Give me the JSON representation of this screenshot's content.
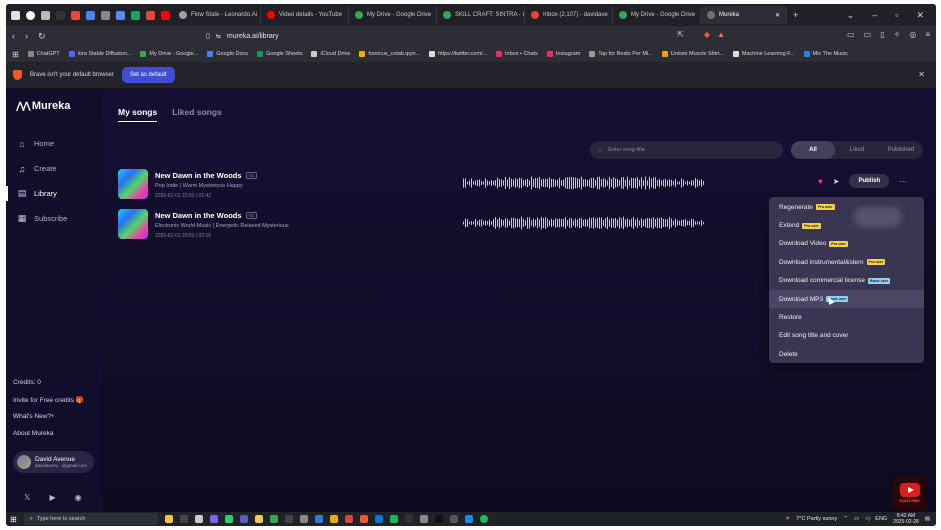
{
  "browser": {
    "tabs": [
      {
        "label": "Flow State - Leonardo.Ai",
        "color": "#9aa0a6"
      },
      {
        "label": "Video details - YouTube",
        "color": "#ff0000"
      },
      {
        "label": "My Drive - Google Drive",
        "color": "#34a853"
      },
      {
        "label": "SKILL CRAFT: SINTRA - G",
        "color": "#34a853"
      },
      {
        "label": "Inbox (2,107) - davidave",
        "color": "#ea4335"
      },
      {
        "label": "My Drive - Google Drive",
        "color": "#34a853"
      },
      {
        "label": "Mureka",
        "color": "#6f6f6f",
        "active": true
      }
    ],
    "url": "mureka.ai/library",
    "bookmarks": [
      {
        "label": "ChatGPT",
        "color": "#888"
      },
      {
        "label": "lora Stable Diffusion...",
        "color": "#4a6cf7"
      },
      {
        "label": "My Drive - Google...",
        "color": "#34a853"
      },
      {
        "label": "Google Docs",
        "color": "#4285f4"
      },
      {
        "label": "Google Sheets",
        "color": "#0f9d58"
      },
      {
        "label": "iCloud Drive",
        "color": "#ccc"
      },
      {
        "label": "fooocus_colab.ipyn...",
        "color": "#f9ab00"
      },
      {
        "label": "https://twitter.com/...",
        "color": "#ddd"
      },
      {
        "label": "Inbox • Chats",
        "color": "#e1306c"
      },
      {
        "label": "Instagram",
        "color": "#e1306c"
      },
      {
        "label": "Tap for Beats Per Mi...",
        "color": "#999"
      },
      {
        "label": "Unisex Muscle Shirt...",
        "color": "#f59e0b"
      },
      {
        "label": "Machine Learning F...",
        "color": "#ddd"
      },
      {
        "label": "Mix The Music",
        "color": "#1e88e5"
      }
    ],
    "infobar": {
      "message": "Brave isn't your default browser",
      "button": "Set as default"
    }
  },
  "app": {
    "logo": "Mureka",
    "nav": [
      {
        "label": "Home",
        "icon": "⌂"
      },
      {
        "label": "Create",
        "icon": "♫"
      },
      {
        "label": "Library",
        "icon": "▤",
        "active": true
      },
      {
        "label": "Subscribe",
        "icon": "▦"
      }
    ],
    "sidebar_bottom": {
      "credits": "Credits: 0",
      "invite": "Invite for Free credits 🎁",
      "whats_new": "What's New?",
      "about": "About Mureka"
    },
    "user": {
      "name": "David Avenue",
      "email": "davidavenu...@gmail.com"
    },
    "tabs": {
      "my_songs": "My songs",
      "liked_songs": "Liked songs"
    },
    "search_placeholder": "Enter song title",
    "filters": [
      "All",
      "Liked",
      "Published"
    ],
    "songs": [
      {
        "title": "New Dawn in the Woods",
        "version": "V1",
        "genre": "Pop Indie | Warm Mysterious Happy",
        "meta": "2025-01-01 23:02 | 01:42"
      },
      {
        "title": "New Dawn in the Woods",
        "version": "V2",
        "genre": "Electronic World-Music | Energetic Relaxed Mysterious",
        "meta": "2025-01-01 23:02 | 02:16"
      }
    ],
    "publish_label": "Publish",
    "menu": [
      {
        "label": "Regenerate",
        "badge": "Pro user",
        "badge_type": "pro"
      },
      {
        "label": "Extend",
        "badge": "Pro user",
        "badge_type": "pro"
      },
      {
        "label": "Download Video",
        "badge": "Pro user",
        "badge_type": "pro"
      },
      {
        "label": "Download instrumental&stem",
        "badge": "Pro user",
        "badge_type": "pro"
      },
      {
        "label": "Download commercial license",
        "badge": "Basic user",
        "badge_type": "proplus"
      },
      {
        "label": "Download MP3",
        "badge": "Basic user",
        "badge_type": "proplus",
        "hover": true
      },
      {
        "label": "Restore"
      },
      {
        "label": "Edit song title and cover"
      },
      {
        "label": "Delete"
      }
    ]
  },
  "taskbar": {
    "search_placeholder": "Type here to search",
    "weather": "7°C  Partly sunny",
    "lang": "ENG",
    "time": "8:42 AM",
    "date": "2025-02-28"
  },
  "overlay": {
    "subscribe": "SUBSCRIBE"
  }
}
